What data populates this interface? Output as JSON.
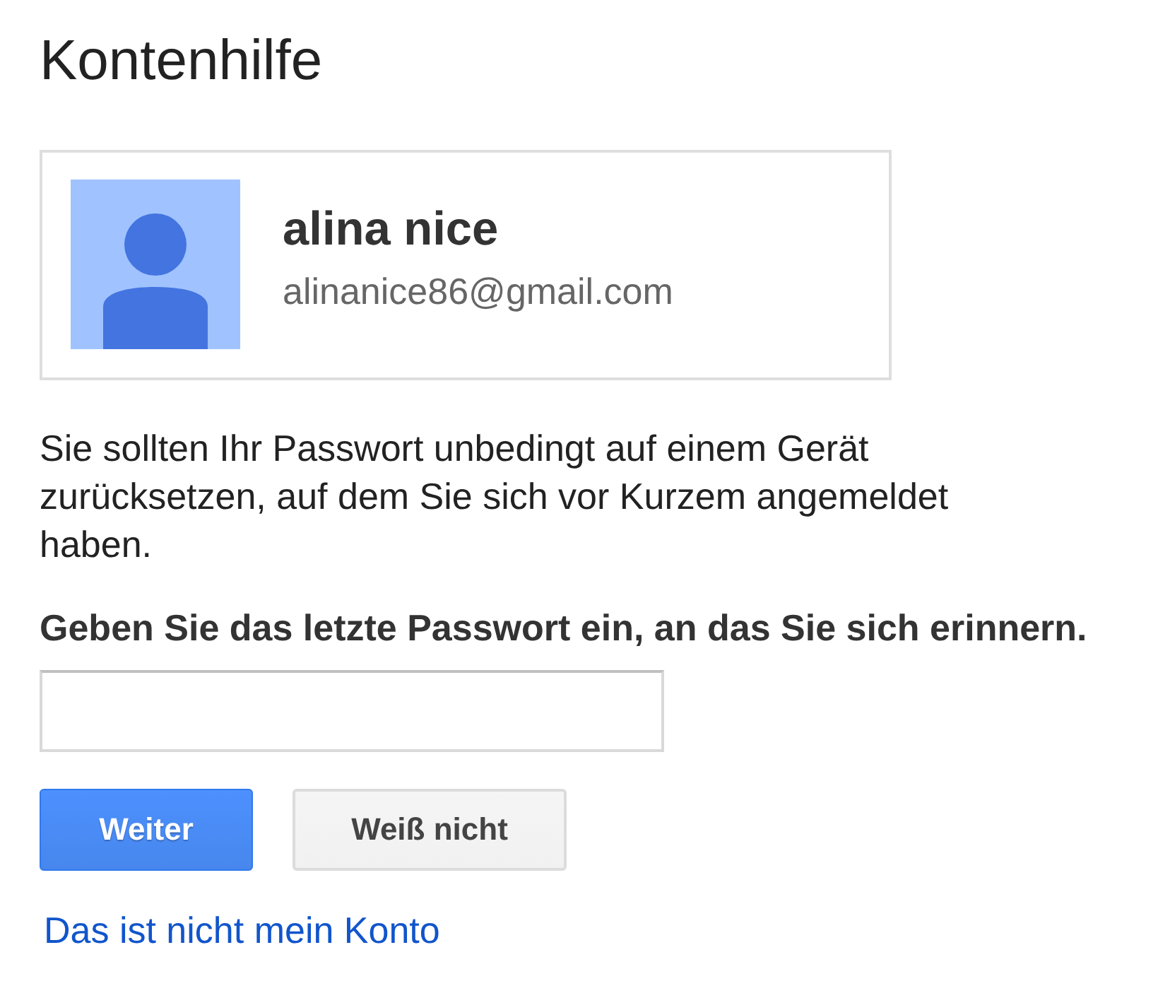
{
  "page": {
    "title": "Kontenhilfe"
  },
  "account": {
    "name": "alina nice",
    "email": "alinanice86@gmail.com"
  },
  "message": "Sie sollten Ihr Passwort unbedingt auf einem Gerät zurücksetzen, auf dem Sie sich vor Kurzem angemeldet haben.",
  "password_prompt": {
    "label": "Geben Sie das letzte Passwort ein, an das Sie sich erinnern."
  },
  "buttons": [
    {
      "label": "Weiter",
      "kind": "primary"
    },
    {
      "label": "Weiß nicht",
      "kind": "secondary"
    }
  ],
  "link": "Das ist nicht mein Konto"
}
